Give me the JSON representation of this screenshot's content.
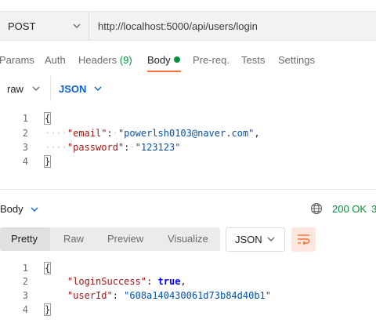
{
  "request": {
    "method": "POST",
    "url": "http://localhost:5000/api/users/login"
  },
  "request_tabs": [
    {
      "label": "Params"
    },
    {
      "label": "Auth"
    },
    {
      "label": "Headers",
      "count": "(9)"
    },
    {
      "label": "Body"
    },
    {
      "label": "Pre-req."
    },
    {
      "label": "Tests"
    },
    {
      "label": "Settings"
    }
  ],
  "body_mode": {
    "type": "raw",
    "format": "JSON"
  },
  "request_body": {
    "line_numbers": [
      "1",
      "2",
      "3",
      "4"
    ],
    "open_brace": "{",
    "close_brace": "}",
    "email_key": "\"email\"",
    "email_value": "\"powerlsh0103@naver.com\"",
    "password_key": "\"password\"",
    "password_value": "\"123123\""
  },
  "response": {
    "section_label": "Body",
    "status": "200 OK",
    "status_extra": "3",
    "view_tabs": [
      "Pretty",
      "Raw",
      "Preview",
      "Visualize"
    ],
    "format": "JSON",
    "line_numbers": [
      "1",
      "2",
      "3",
      "4"
    ],
    "open_brace": "{",
    "close_brace": "}",
    "login_key": "\"loginSuccess\"",
    "login_value": "true",
    "userid_key": "\"userId\"",
    "userid_value": "\"608a140430061d73b84d40b1\""
  },
  "colors": {
    "accent": "#ff6c37",
    "success": "#0a8f3c",
    "link": "#0b5fcf"
  }
}
